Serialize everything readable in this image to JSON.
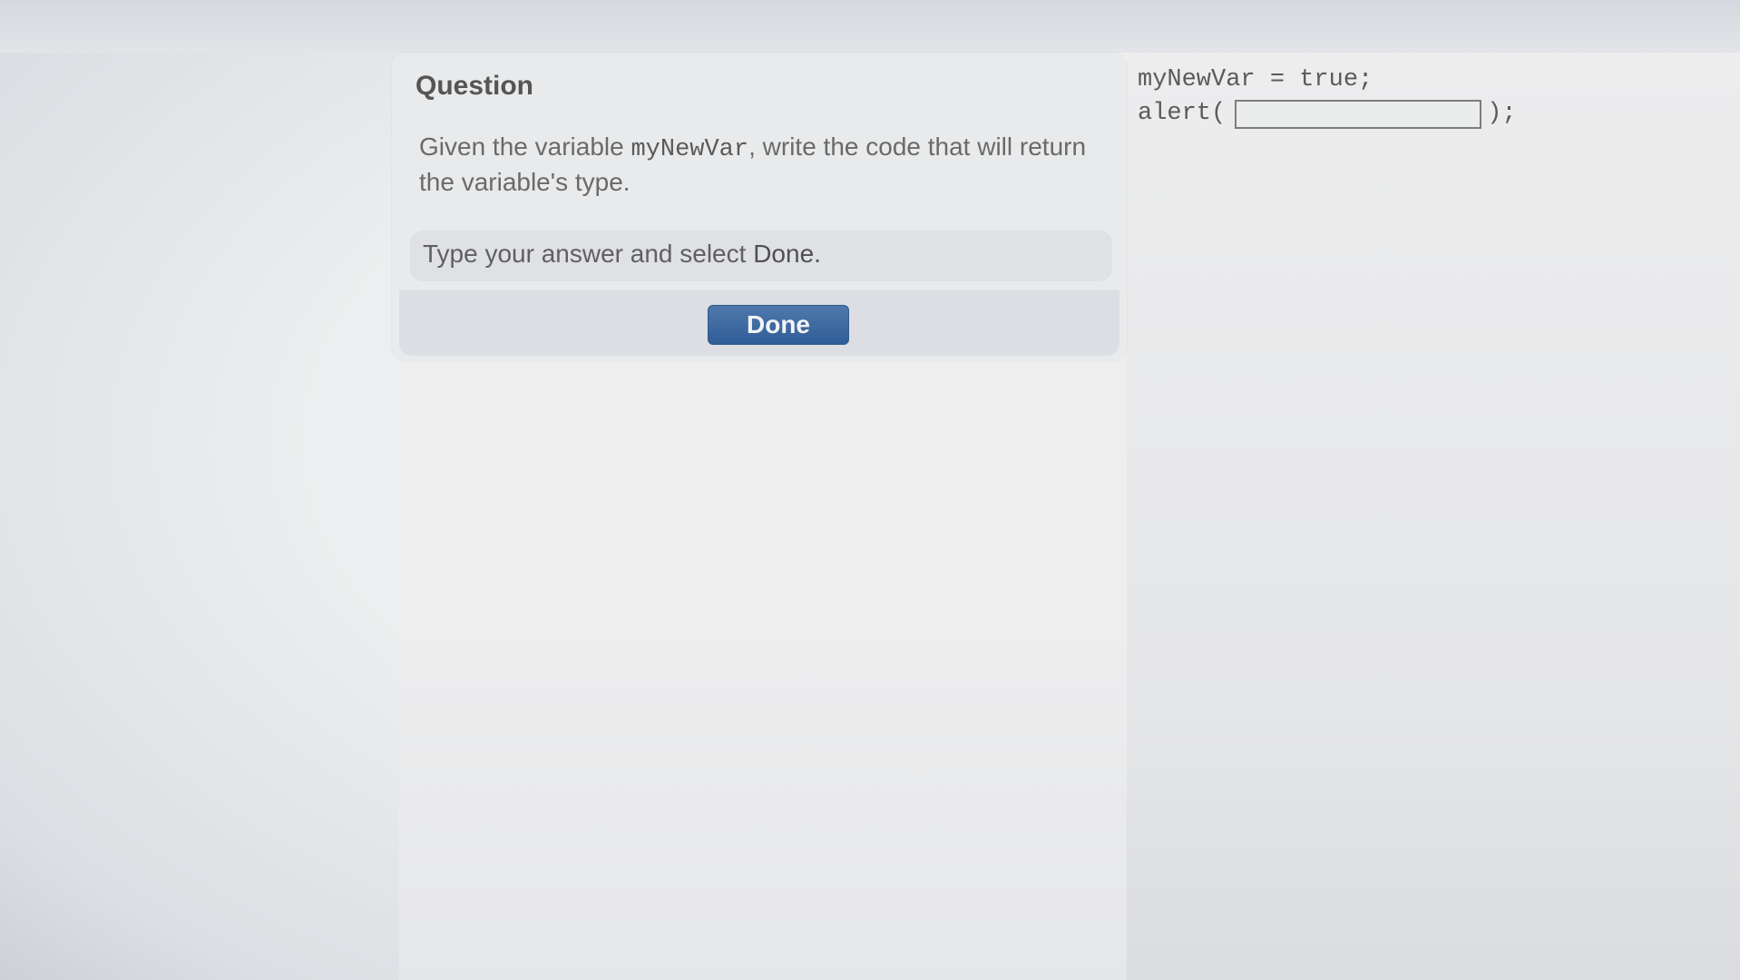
{
  "question": {
    "heading": "Question",
    "text_before": "Given the variable ",
    "variable_name": "myNewVar",
    "text_after": ", write the code that will return the variable's type.",
    "instruction_before": "Type your answer and select ",
    "instruction_done": "Done.",
    "done_button_label": "Done"
  },
  "code": {
    "line1": "myNewVar = true;",
    "alert_prefix": "alert(",
    "alert_suffix": ");",
    "answer_value": "",
    "answer_placeholder": ""
  },
  "colors": {
    "button": "#2f5d96",
    "panel": "#e9eaeb"
  }
}
